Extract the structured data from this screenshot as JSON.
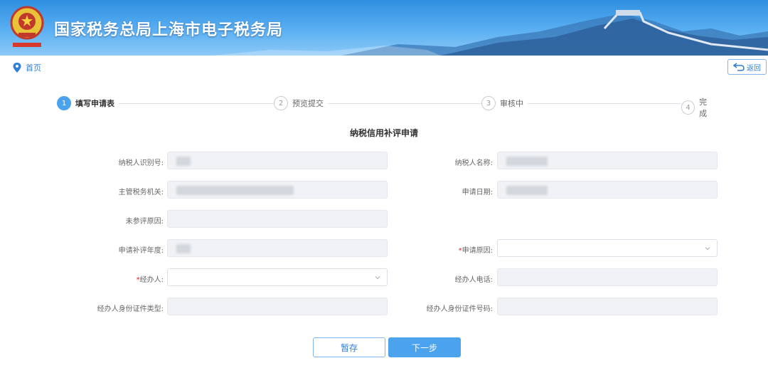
{
  "header": {
    "title": "国家税务总局上海市电子税务局",
    "logo_icon": "tax-emblem-icon",
    "brand_color": "#2f8fe0"
  },
  "breadcrumb": {
    "home_label": "首页",
    "icon": "location-pin-icon"
  },
  "back_button": {
    "label": "返回",
    "icon": "return-arrow-icon"
  },
  "steps": [
    {
      "num": "1",
      "label": "填写申请表",
      "active": true
    },
    {
      "num": "2",
      "label": "预览提交",
      "active": false
    },
    {
      "num": "3",
      "label": "审核中",
      "active": false
    },
    {
      "num": "4",
      "label": "完成",
      "active": false
    }
  ],
  "form": {
    "title": "纳税信用补评申请",
    "fields": {
      "taxpayer_id": {
        "label": "纳税人识别号:",
        "value": ""
      },
      "taxpayer_name": {
        "label": "纳税人名称:",
        "value": ""
      },
      "tax_authority": {
        "label": "主管税务机关:",
        "value": ""
      },
      "apply_date": {
        "label": "申请日期:",
        "value": ""
      },
      "not_rated_reason": {
        "label": "未参评原因:",
        "value": ""
      },
      "apply_year": {
        "label": "申请补评年度:",
        "value": ""
      },
      "apply_reason": {
        "label": "申请原因:",
        "required_mark": "*",
        "value": ""
      },
      "handler": {
        "label": "经办人:",
        "required_mark": "*",
        "value": ""
      },
      "handler_phone": {
        "label": "经办人电话:",
        "value": ""
      },
      "handler_id_type": {
        "label": "经办人身份证件类型:",
        "value": ""
      },
      "handler_id_number": {
        "label": "经办人身份证件号码:",
        "value": ""
      }
    }
  },
  "actions": {
    "save_label": "暂存",
    "next_label": "下一步"
  }
}
